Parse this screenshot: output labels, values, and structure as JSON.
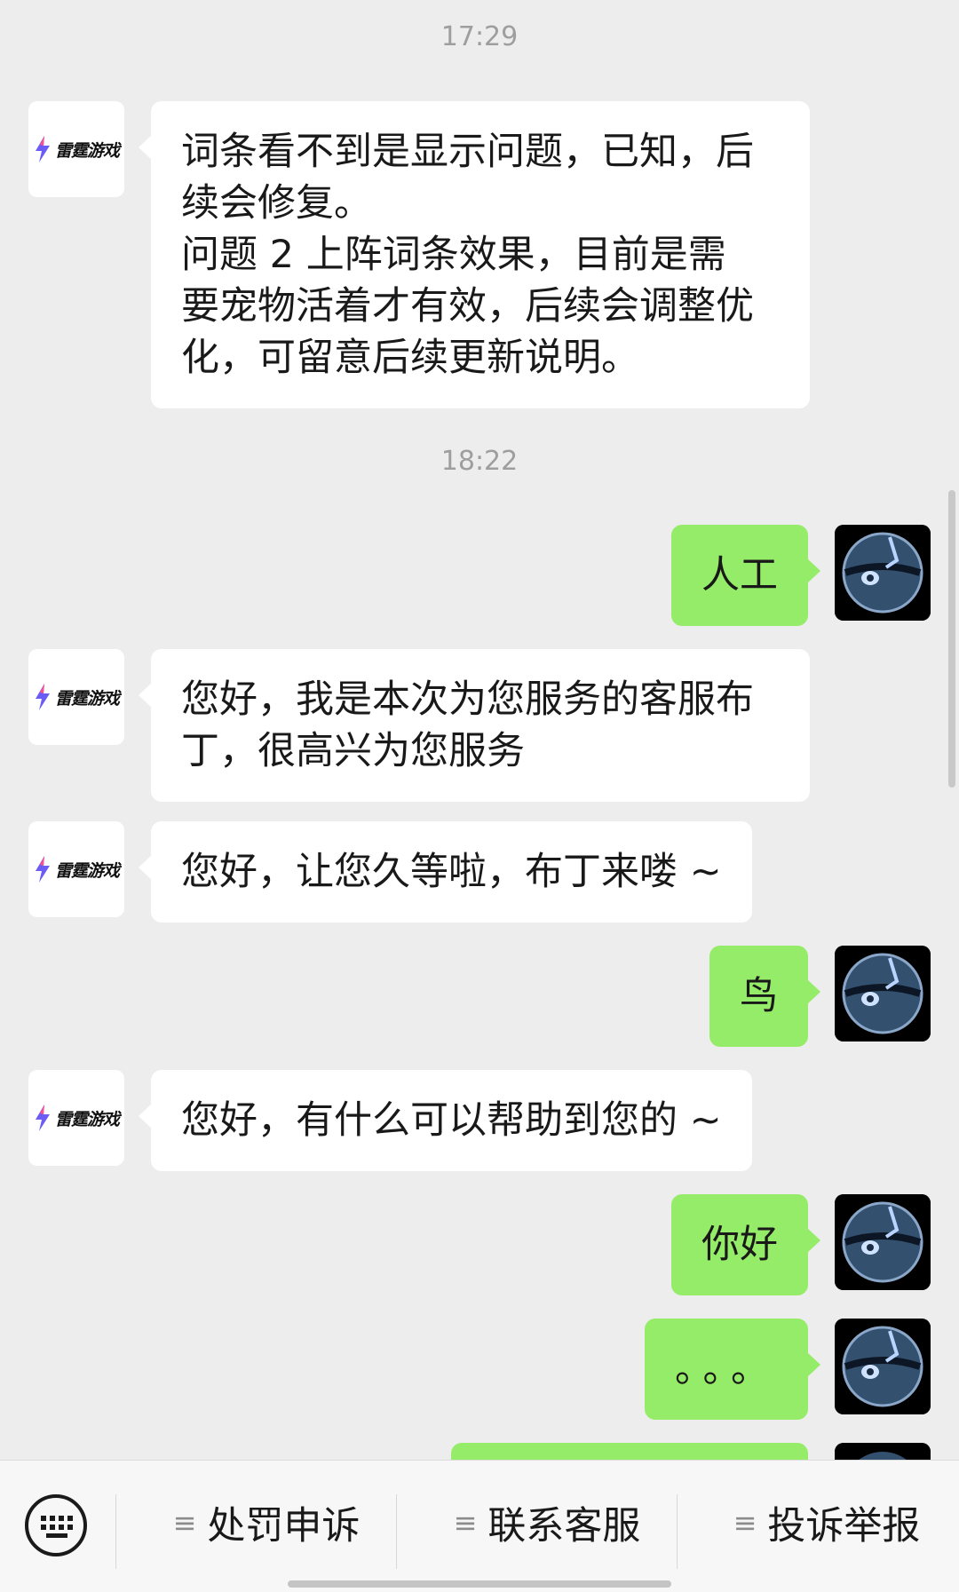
{
  "timestamps": [
    "17:29",
    "18:22"
  ],
  "service_name": "雷霆游戏",
  "messages": [
    {
      "side": "in",
      "text": "词条看不到是显示问题，已知，后\n续会修复。\n问题 2 上阵词条效果，目前是需\n要宠物活着才有效，后续会调整优\n化，可留意后续更新说明。"
    },
    {
      "side": "out",
      "text": "人工"
    },
    {
      "side": "in",
      "text": "您好，我是本次为您服务的客服布\n丁，很高兴为您服务"
    },
    {
      "side": "in",
      "text": "您好，让您久等啦，布丁来喽 ~"
    },
    {
      "side": "out",
      "text": "鸟"
    },
    {
      "side": "in",
      "text": "您好，有什么可以帮助到您的 ~"
    },
    {
      "side": "out",
      "text": "你好"
    },
    {
      "side": "out",
      "text": "。。。"
    },
    {
      "side": "out",
      "text": ""
    }
  ],
  "bottom_menu": {
    "keyboard_icon": "keyboard-icon",
    "items": [
      {
        "label": "处罚申诉",
        "icon": "menu-list-icon"
      },
      {
        "label": "联系客服",
        "icon": "menu-list-icon"
      },
      {
        "label": "投诉举报",
        "icon": "menu-list-icon"
      }
    ]
  },
  "colors": {
    "background": "#ededed",
    "incoming_bubble": "#ffffff",
    "outgoing_bubble": "#95ec69",
    "timestamp": "#9e9e9e"
  }
}
